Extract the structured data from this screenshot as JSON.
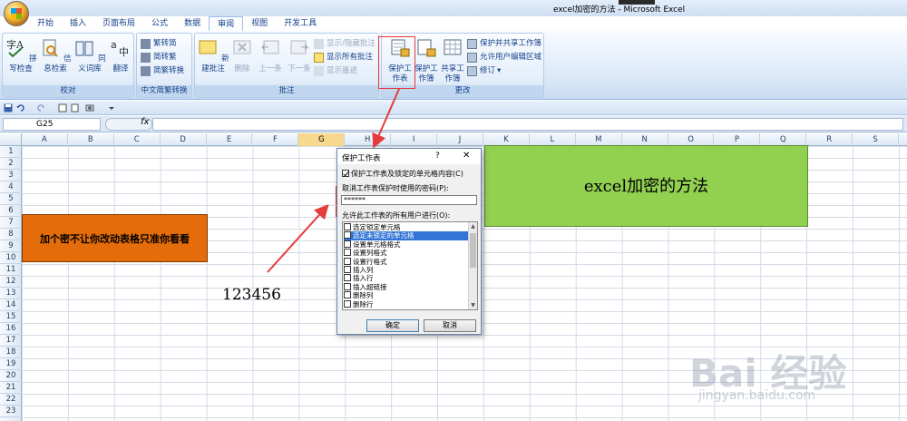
{
  "window": {
    "title": "excel加密的方法 - Microsoft Excel"
  },
  "tabs": [
    "开始",
    "插入",
    "页面布局",
    "公式",
    "数据",
    "审阅",
    "视图",
    "开发工具"
  ],
  "active_tab": "审阅",
  "ribbon": {
    "proofing": {
      "label": "校对",
      "spell_check": "拼写检查",
      "research": "信息检索",
      "thesaurus": "同义词库",
      "translate": "翻译"
    },
    "chinese_conversion": {
      "label": "中文简繁转换",
      "to_traditional": "繁转简",
      "to_simplified": "简转繁",
      "conversion": "简繁转换"
    },
    "comments": {
      "label": "批注",
      "new_comment": "新建批注",
      "delete": "删除",
      "previous": "上一条",
      "next": "下一条",
      "show_hide": "显示/隐藏批注",
      "show_all": "显示所有批注",
      "show_ink": "显示墨迹"
    },
    "changes": {
      "label": "更改",
      "protect_sheet": "保护工作表",
      "protect_workbook": "保护工作簿",
      "share_workbook": "共享工作簿",
      "protect_and_share": "保护并共享工作簿",
      "allow_edit_ranges": "允许用户编辑区域",
      "track_changes": "修订"
    }
  },
  "name_box": "G25",
  "fx_label": "fx",
  "columns": [
    "A",
    "B",
    "C",
    "D",
    "E",
    "F",
    "G",
    "H",
    "I",
    "J",
    "K",
    "L",
    "M",
    "N",
    "O",
    "P",
    "Q",
    "R",
    "S"
  ],
  "selected_column": "G",
  "rows": [
    "1",
    "2",
    "3",
    "4",
    "5",
    "6",
    "7",
    "8",
    "9",
    "10",
    "11",
    "12",
    "13",
    "14",
    "15",
    "16",
    "17",
    "18",
    "19",
    "20",
    "21",
    "22",
    "23"
  ],
  "cells": {
    "orange_text": "加个密不让你改动表格只准你看看",
    "green_text": "excel加密的方法",
    "password_note": "123456"
  },
  "dialog": {
    "title": "保护工作表",
    "help": "?",
    "close": "✕",
    "protect_checkbox_label": "保护工作表及锁定的单元格内容(C)",
    "protect_checked": true,
    "password_label": "取消工作表保护时使用的密码(P):",
    "password_value": "******",
    "permissions_label": "允许此工作表的所有用户进行(O):",
    "permissions": [
      {
        "label": "选定锁定单元格",
        "checked": false,
        "selected": false
      },
      {
        "label": "选定未锁定的单元格",
        "checked": false,
        "selected": true
      },
      {
        "label": "设置单元格格式",
        "checked": false,
        "selected": false
      },
      {
        "label": "设置列格式",
        "checked": false,
        "selected": false
      },
      {
        "label": "设置行格式",
        "checked": false,
        "selected": false
      },
      {
        "label": "插入列",
        "checked": false,
        "selected": false
      },
      {
        "label": "插入行",
        "checked": false,
        "selected": false
      },
      {
        "label": "插入超链接",
        "checked": false,
        "selected": false
      },
      {
        "label": "删除列",
        "checked": false,
        "selected": false
      },
      {
        "label": "删除行",
        "checked": false,
        "selected": false
      }
    ],
    "ok": "确定",
    "cancel": "取消"
  },
  "watermark": {
    "brand": "Bai 经验",
    "url": "jingyan.baidu.com"
  },
  "colors": {
    "orange_fill": "#e46c0a",
    "green_fill": "#92d050",
    "annotation_red": "#e53b3b",
    "selected_list_item": "#3375d6"
  }
}
